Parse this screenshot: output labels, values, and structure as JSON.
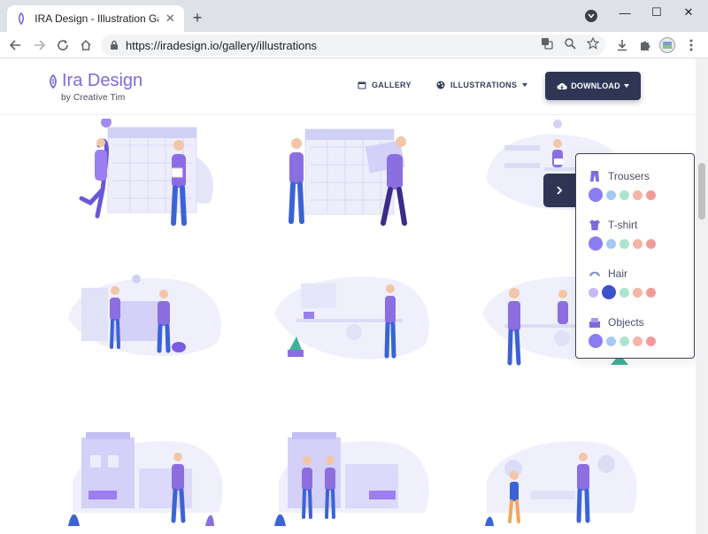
{
  "browser": {
    "tab_title": "IRA Design - Illustration Gallery",
    "tab_close": "✕",
    "new_tab": "+",
    "url": "https://iradesign.io/gallery/illustrations",
    "window_controls": [
      "—",
      "☐",
      "✕"
    ]
  },
  "site": {
    "brand_name": "Ira Design",
    "brand_sub": "by Creative Tim",
    "nav": {
      "gallery": "GALLERY",
      "illustrations": "ILLUSTRATIONS",
      "download": "DOWNLOAD"
    }
  },
  "customizer": {
    "groups": [
      {
        "label": "Trousers",
        "icon": "trousers-icon",
        "swatches": [
          "#8b7cf2",
          "#a5c9f0",
          "#aee3cf",
          "#f5b5a4",
          "#f29b9b"
        ],
        "selected": 0
      },
      {
        "label": "T-shirt",
        "icon": "tshirt-icon",
        "swatches": [
          "#8b7cf2",
          "#a5c9f0",
          "#aee3cf",
          "#f5b5a4",
          "#f29b9b"
        ],
        "selected": 0
      },
      {
        "label": "Hair",
        "icon": "hair-icon",
        "swatches": [
          "#c8b7f5",
          "#3f51c8",
          "#aee3cf",
          "#f5b5a4",
          "#f29b9b"
        ],
        "selected": 1
      },
      {
        "label": "Objects",
        "icon": "objects-icon",
        "swatches": [
          "#8b7cf2",
          "#a5c9f0",
          "#aee3cf",
          "#f5b5a4",
          "#f29b9b"
        ],
        "selected": 0
      }
    ]
  },
  "colors": {
    "accent": "#7d6bd8",
    "dark": "#2e3654",
    "illustration_purple": "#8b6fe0",
    "illustration_blue": "#3b7ff0",
    "illustration_light": "#e9e9fb"
  }
}
